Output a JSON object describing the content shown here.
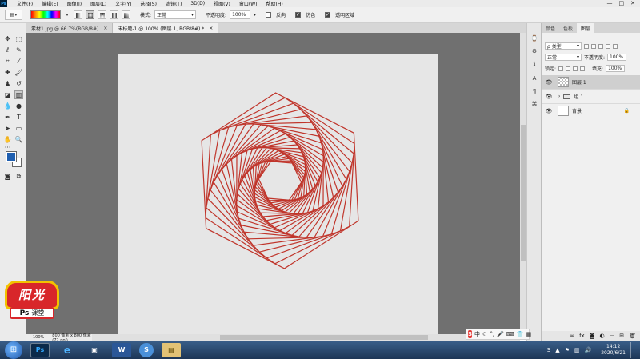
{
  "menu": {
    "ps_logo": "Ps",
    "items": [
      "文件(F)",
      "编辑(E)",
      "图像(I)",
      "图层(L)",
      "文字(Y)",
      "选择(S)",
      "滤镜(T)",
      "3D(D)",
      "视图(V)",
      "窗口(W)",
      "帮助(H)"
    ],
    "window_controls": [
      "—",
      "□",
      "✕"
    ]
  },
  "options": {
    "mode_label": "模式:",
    "mode_value": "正常",
    "opacity_label": "不透明度:",
    "opacity_value": "100%",
    "reverse_label": "反向",
    "dither_label": "仿色",
    "transparency_label": "透明区域"
  },
  "tabs": [
    {
      "label": "素材1.jpg @ 66.7%(RGB/8#)",
      "close": "×"
    },
    {
      "label": "未标题-1 @ 100% (图层 1, RGB/8#) *",
      "close": "×"
    }
  ],
  "status": {
    "zoom": "100%",
    "doc_size": "800 像素 x 800 像素 (72 ppi)"
  },
  "layers_panel": {
    "tabs": [
      "颜色",
      "色板",
      "图层"
    ],
    "filter_label": "ρ 类型",
    "blend_mode": "正常",
    "opacity_label": "不透明度:",
    "opacity_value": "100%",
    "lock_label": "锁定:",
    "fill_label": "填充:",
    "fill_value": "100%",
    "layers": [
      {
        "name": "图层 1"
      },
      {
        "name": "组 1"
      },
      {
        "name": "背景"
      }
    ]
  },
  "watermark": {
    "title": "阳光",
    "badge_ps": "Ps",
    "badge_text": "课堂"
  },
  "ime": {
    "logo": "S",
    "lang": "中"
  },
  "taskbar": {
    "apps": [
      "Ps",
      "e",
      "▣",
      "W",
      "S",
      "▤"
    ],
    "time": "14:12",
    "date": "2020/6/21"
  },
  "colors": {
    "foreground": "#1f5fb0",
    "background": "#ffffff",
    "stroke": "#c0352b"
  },
  "icons": {
    "toolbar": [
      "move-icon",
      "marquee-icon",
      "lasso-icon",
      "quick-select-icon",
      "crop-icon",
      "eyedropper-icon",
      "healing-icon",
      "brush-icon",
      "stamp-icon",
      "history-brush-icon",
      "eraser-icon",
      "gradient-icon",
      "blur-icon",
      "dodge-icon",
      "pen-icon",
      "type-icon",
      "path-select-icon",
      "shape-icon",
      "hand-icon",
      "zoom-icon",
      "more-tools-icon"
    ]
  }
}
